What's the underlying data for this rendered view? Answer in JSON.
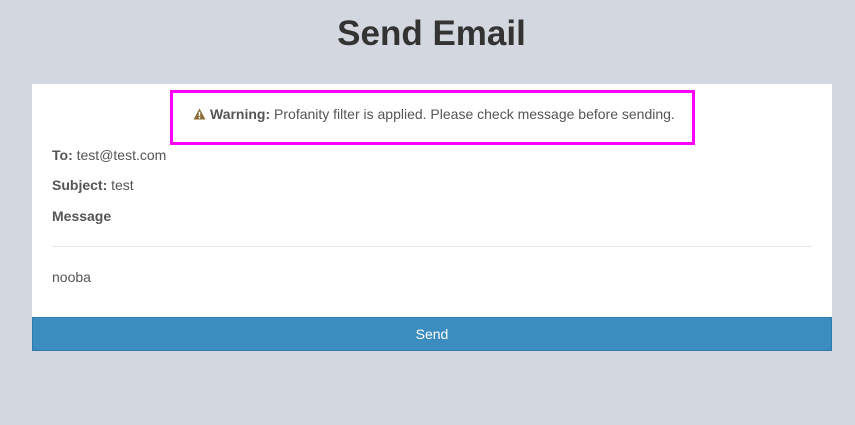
{
  "page": {
    "title": "Send Email"
  },
  "warning": {
    "icon": "warning-triangle-icon",
    "label": "Warning:",
    "text": " Profanity filter is applied. Please check message before sending.",
    "highlight_color": "#ff00ff"
  },
  "email": {
    "to_label": "To:",
    "to_value": " test@test.com",
    "subject_label": "Subject:",
    "subject_value": " test",
    "message_label": "Message",
    "message_body": "nooba"
  },
  "actions": {
    "send_label": "Send",
    "send_color": "#3b8dbf"
  }
}
